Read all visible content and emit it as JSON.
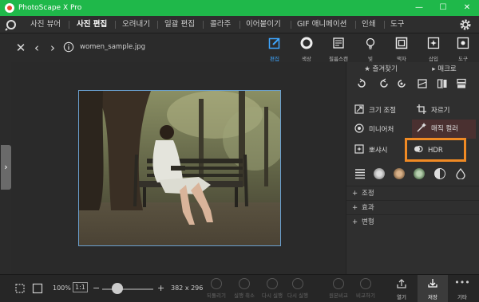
{
  "app": {
    "title": "PhotoScape X Pro"
  },
  "window": {
    "minimize": "—",
    "maximize": "☐",
    "close": "✕"
  },
  "menu": [
    {
      "label": "사진 뷰어",
      "active": false
    },
    {
      "label": "사진 편집",
      "active": true
    },
    {
      "label": "오려내기",
      "active": false
    },
    {
      "label": "일괄 편집",
      "active": false
    },
    {
      "label": "콜라주",
      "active": false
    },
    {
      "label": "이어붙이기",
      "active": false
    },
    {
      "label": "GIF 애니메이션",
      "active": false
    },
    {
      "label": "인쇄",
      "active": false
    },
    {
      "label": "도구",
      "active": false
    }
  ],
  "file": {
    "name": "women_sample.jpg"
  },
  "toolbar": {
    "edit": "편집",
    "color": "색상",
    "film": "필름스캔",
    "light": "빛",
    "frame": "액자",
    "insert": "삽입",
    "tools": "도구"
  },
  "panel": {
    "tab_favorites": "즐겨찾기",
    "tab_macro": "매크로",
    "resize": "크기 조절",
    "crop": "자르기",
    "miniature": "미니어처",
    "magic_color": "매직 컬러",
    "bokeh": "뽀샤시",
    "hdr": "HDR",
    "sections": {
      "adjust": "조정",
      "effects": "효과",
      "transform": "변형"
    },
    "plus": "+"
  },
  "bottom": {
    "zoom": "100%",
    "one_to_one": "1:1",
    "minus": "−",
    "plus": "+",
    "dimensions": "382 x 296",
    "zoom_level": 0.3,
    "undo_all": "되돌리기",
    "undo": "실행 취소",
    "redo": "다시 실행",
    "redo_all": "다시 실행",
    "compare": "원본비교",
    "compare_orig": "비교하기",
    "open": "열기",
    "save": "저장",
    "more": "기타"
  }
}
